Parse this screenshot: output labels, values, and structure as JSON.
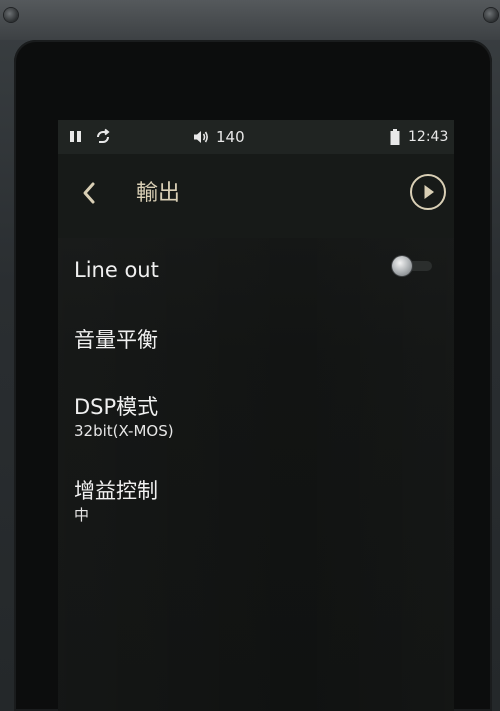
{
  "status_bar": {
    "volume": "140",
    "time": "12:43",
    "icons": [
      "pause-icon",
      "repeat-icon",
      "volume-icon",
      "battery-icon"
    ]
  },
  "header": {
    "title": "輸出",
    "back_icon": "chevron-left-icon",
    "play_icon": "play-icon"
  },
  "settings": [
    {
      "title": "Line out",
      "toggle": {
        "on": false
      }
    },
    {
      "title": "音量平衡"
    },
    {
      "title": "DSP模式",
      "value": "32bit(X-MOS)"
    },
    {
      "title": "增益控制",
      "value": "中"
    }
  ],
  "colors": {
    "accent": "#d9cfb5",
    "text": "#f0f0f0",
    "screen_bg": "#121413",
    "status_bg": "#202422"
  }
}
